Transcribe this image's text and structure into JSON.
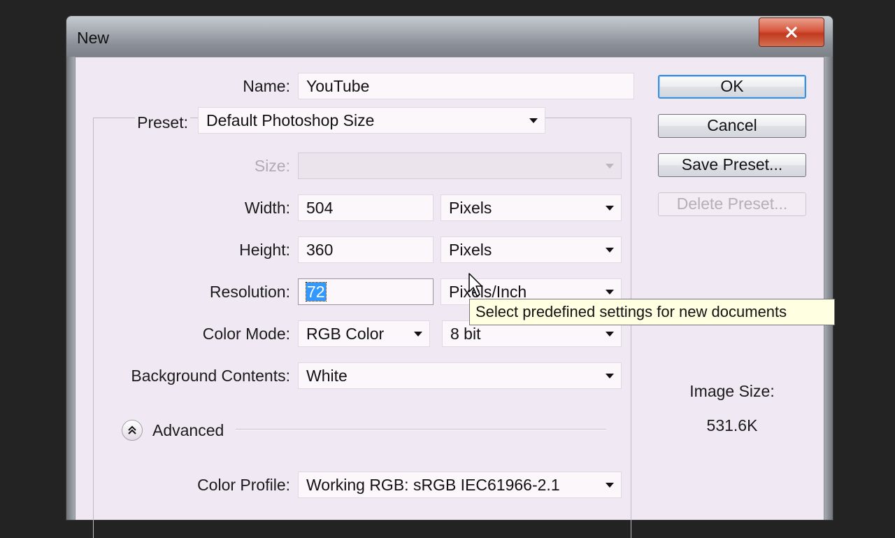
{
  "window": {
    "title": "New"
  },
  "form": {
    "name": {
      "label": "Name:",
      "value": "YouTube"
    },
    "preset": {
      "label": "Preset:",
      "value": "Default Photoshop Size"
    },
    "size": {
      "label": "Size:",
      "value": ""
    },
    "width": {
      "label": "Width:",
      "value": "504",
      "unit": "Pixels"
    },
    "height": {
      "label": "Height:",
      "value": "360",
      "unit": "Pixels"
    },
    "resolution": {
      "label": "Resolution:",
      "value": "72",
      "unit": "Pixels/Inch"
    },
    "color_mode": {
      "label": "Color Mode:",
      "value": "RGB Color",
      "depth": "8 bit"
    },
    "background": {
      "label": "Background Contents:",
      "value": "White"
    },
    "advanced": {
      "label": "Advanced"
    },
    "color_profile": {
      "label": "Color Profile:",
      "value": "Working RGB:  sRGB IEC61966-2.1"
    }
  },
  "buttons": {
    "ok": "OK",
    "cancel": "Cancel",
    "save_preset": "Save Preset...",
    "delete_preset": "Delete Preset..."
  },
  "image_size": {
    "label": "Image Size:",
    "value": "531.6K"
  },
  "tooltip": "Select predefined settings for new documents"
}
